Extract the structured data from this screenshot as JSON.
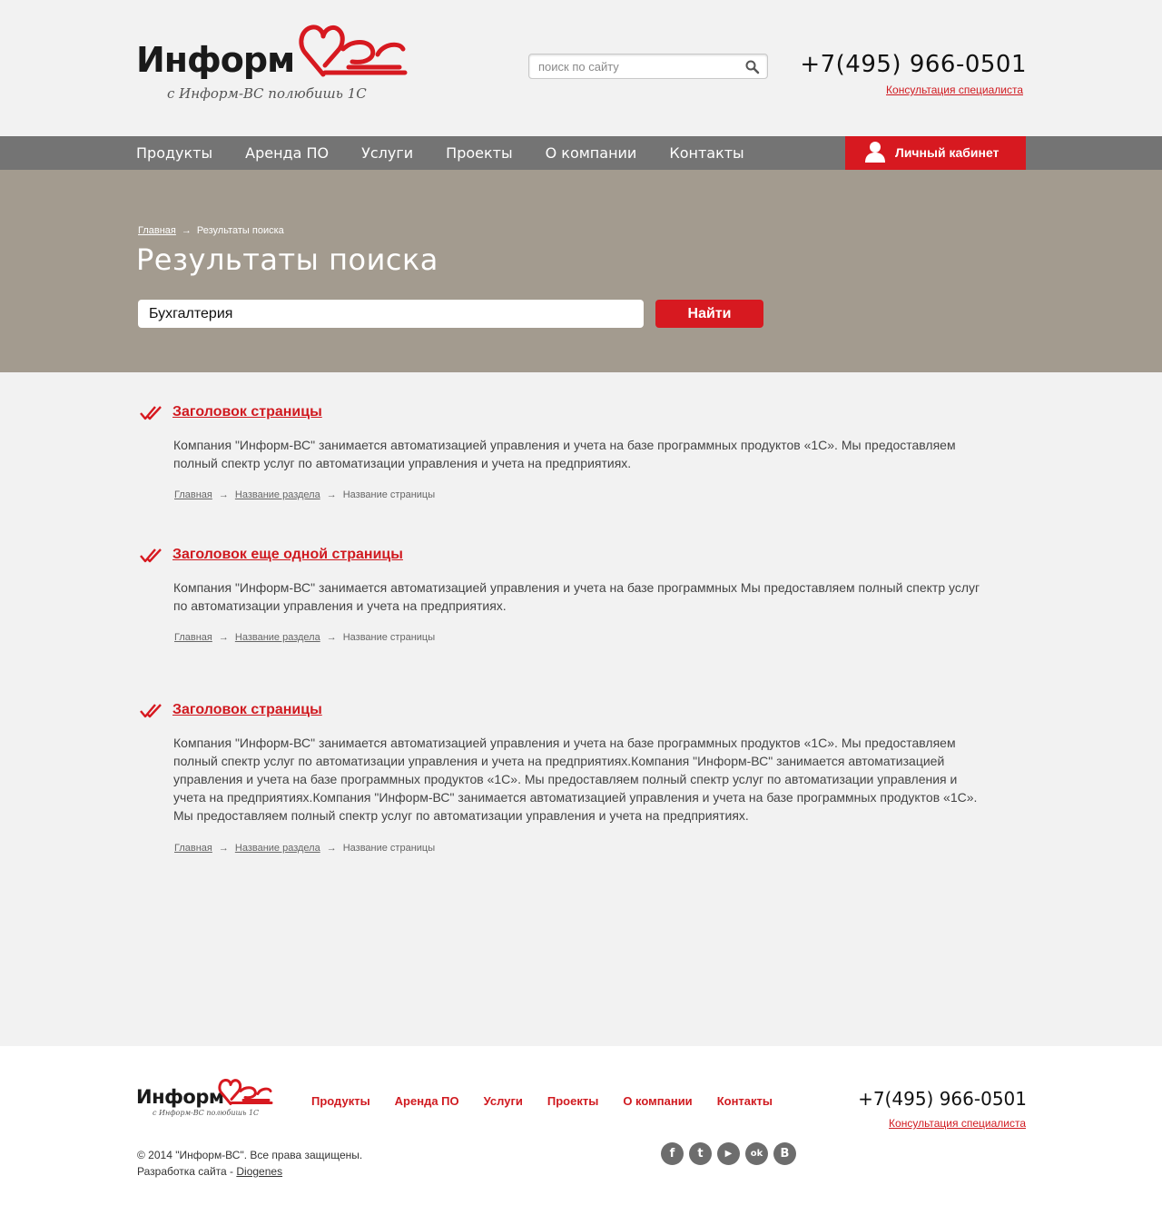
{
  "header": {
    "logo_text": "Информ",
    "logo_tagline": "с Информ-ВС полюбишь 1С",
    "search_placeholder": "поиск по сайту",
    "phone": "+7(495) 966-0501",
    "consult_link": "Консультация специалиста"
  },
  "nav": {
    "items": [
      "Продукты",
      "Аренда ПО",
      "Услуги",
      "Проекты",
      "О компании",
      "Контакты"
    ],
    "cabinet_label": "Личный кабинет"
  },
  "banner": {
    "breadcrumb_home": "Главная",
    "breadcrumb_current": "Результаты поиска",
    "title": "Результаты поиска",
    "query_value": "Бухгалтерия",
    "find_label": "Найти"
  },
  "results": [
    {
      "title": "Заголовок страницы",
      "text": "Компания \"Информ-ВС\" занимается автоматизацией управления и учета на базе программных продуктов «1С». Мы предоставляем полный спектр услуг по автоматизации управления и учета на предприятиях.",
      "crumbs": [
        "Главная",
        "Название раздела",
        "Название страницы"
      ]
    },
    {
      "title": "Заголовок еще одной страницы",
      "text": "Компания \"Информ-ВС\" занимается автоматизацией управления и учета на базе программных Мы предоставляем полный спектр услуг по автоматизации управления и учета на предприятиях.",
      "crumbs": [
        "Главная",
        "Название раздела",
        "Название страницы"
      ]
    },
    {
      "title": "Заголовок страницы",
      "text": "Компания \"Информ-ВС\" занимается автоматизацией управления и учета на базе программных продуктов «1С». Мы предоставляем полный спектр услуг по автоматизации управления и учета на предприятиях.Компания \"Информ-ВС\" занимается автоматизацией управления и учета на базе программных продуктов «1С». Мы предоставляем полный спектр услуг по автоматизации управления и учета на предприятиях.Компания \"Информ-ВС\" занимается автоматизацией управления и учета на базе программных продуктов «1С». Мы предоставляем полный спектр услуг по автоматизации управления и учета на предприятиях.",
      "crumbs": [
        "Главная",
        "Название раздела",
        "Название страницы"
      ]
    }
  ],
  "footer": {
    "logo_text": "Информ",
    "logo_tagline": "с Информ-ВС полюбишь 1С",
    "nav": [
      "Продукты",
      "Аренда ПО",
      "Услуги",
      "Проекты",
      "О компании",
      "Контакты"
    ],
    "phone": "+7(495) 966-0501",
    "consult_link": "Консультация специалиста",
    "copyright": "© 2014 \"Информ-ВС\". Все права защищены.",
    "dev_prefix": "Разработка сайта - ",
    "dev_link": "Diogenes",
    "social": [
      {
        "icon": "facebook-icon",
        "glyph": "f"
      },
      {
        "icon": "twitter-icon",
        "glyph": "t"
      },
      {
        "icon": "youtube-icon",
        "glyph": "▶"
      },
      {
        "icon": "odnoklassniki-icon",
        "glyph": "ok"
      },
      {
        "icon": "vkontakte-icon",
        "glyph": "B"
      }
    ]
  },
  "colors": {
    "brand_red": "#d71920",
    "nav_bg": "#747474",
    "banner_bg": "#a39b8f",
    "page_bg": "#f2f2f2"
  }
}
